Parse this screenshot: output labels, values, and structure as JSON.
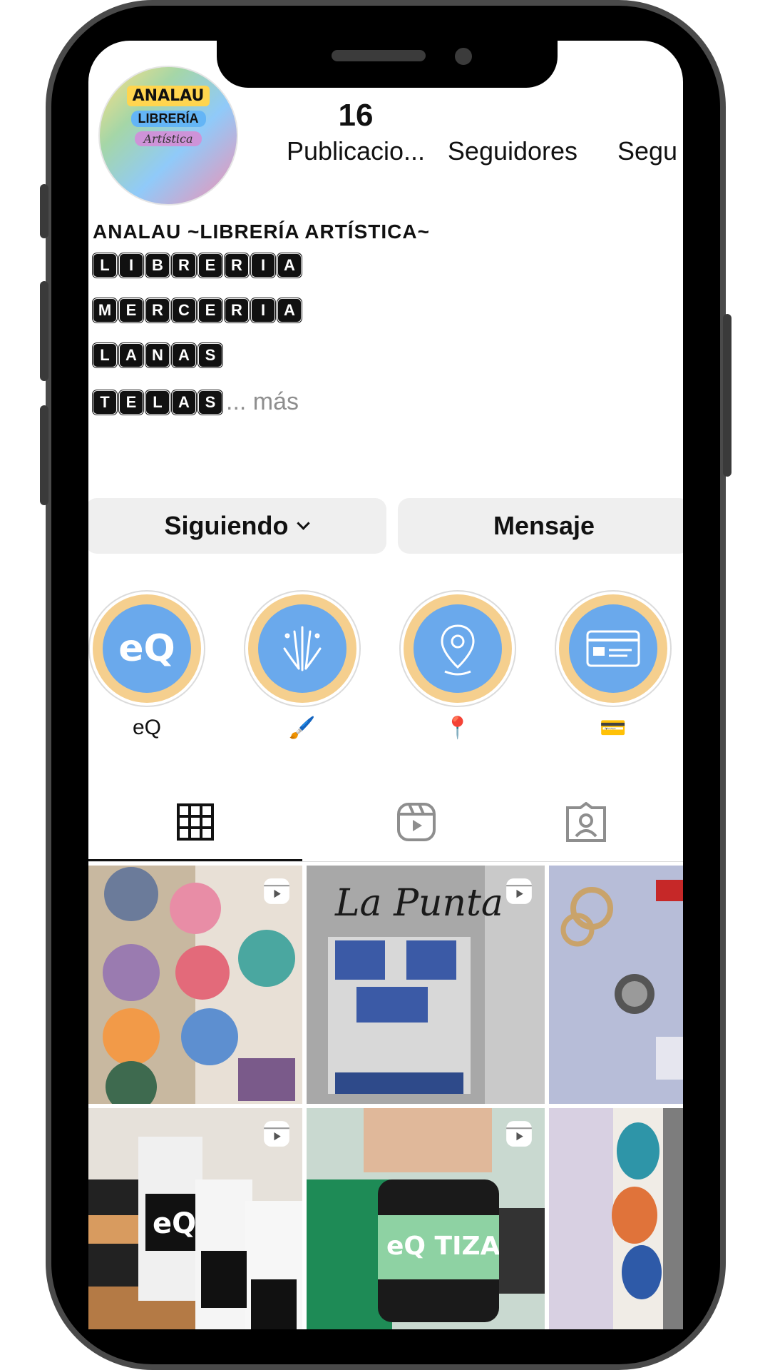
{
  "profile": {
    "avatar_text": {
      "line1": "ANALAU",
      "line2": "LIBRERÍA",
      "line3": "Artística"
    },
    "stats": [
      {
        "number": "16",
        "label": "Publicacio..."
      },
      {
        "number": "",
        "label": "Seguidores"
      },
      {
        "number": "",
        "label": "Segu"
      }
    ],
    "username": "ANALAU ~LIBRERÍA ARTÍSTICA~",
    "bio_lines": [
      [
        "L",
        "I",
        "B",
        "R",
        "E",
        "R",
        "I",
        "A"
      ],
      [
        "M",
        "E",
        "R",
        "C",
        "E",
        "R",
        "I",
        "A"
      ],
      [
        "L",
        "A",
        "N",
        "A",
        "S"
      ],
      [
        "T",
        "E",
        "L",
        "A",
        "S"
      ]
    ],
    "more_label": "... más"
  },
  "actions": {
    "following_label": "Siguiendo",
    "message_label": "Mensaje"
  },
  "highlights": [
    {
      "icon": "eq-logo-icon",
      "label": "eQ",
      "inner": "eQ"
    },
    {
      "icon": "paintbrush-icon",
      "label": "🖌️"
    },
    {
      "icon": "location-pin-icon",
      "label": "📍"
    },
    {
      "icon": "credit-card-icon",
      "label": "💳"
    }
  ],
  "tabs": [
    {
      "icon": "grid-icon",
      "active": true
    },
    {
      "icon": "reels-icon",
      "active": false
    },
    {
      "icon": "tagged-icon",
      "active": false
    }
  ],
  "posts": [
    {
      "desc_icon": "reel-icon",
      "colors": [
        "#6b7b9a",
        "#e88da6",
        "#4aa7a0",
        "#f29a48"
      ]
    },
    {
      "desc_icon": "reel-icon",
      "text": "La Punta",
      "colors": [
        "#9b9b9b",
        "#3b5aa6",
        "#bfbfbf",
        "#d8d8d8"
      ]
    },
    {
      "desc_icon": "none",
      "colors": [
        "#b7bdd8",
        "#c9a36b",
        "#555555",
        "#e6e6ef"
      ]
    },
    {
      "desc_icon": "reel-icon",
      "text": "eQ",
      "colors": [
        "#e6e1da",
        "#222222",
        "#f0f0f0",
        "#d89b5f"
      ]
    },
    {
      "desc_icon": "reel-icon",
      "text": "eQ TIZA",
      "colors": [
        "#c9d9d0",
        "#8ed2a3",
        "#1a1a1a",
        "#1e8b56"
      ]
    },
    {
      "desc_icon": "none",
      "colors": [
        "#c9b9d9",
        "#2e95a8",
        "#e0733a",
        "#7d7d7d"
      ]
    }
  ]
}
